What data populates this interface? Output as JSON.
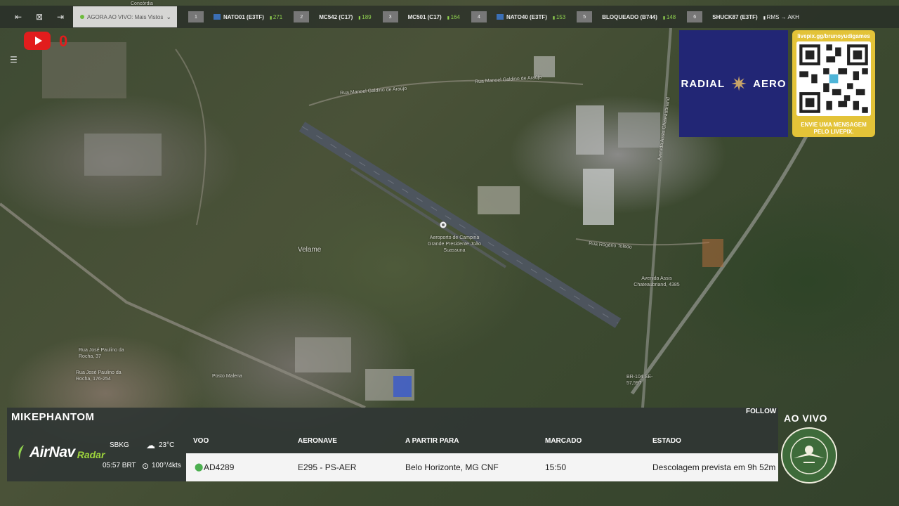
{
  "topbar": {
    "live_label": "AGORA AO VIVO: Mais Vistos",
    "slots": [
      {
        "rank": "1",
        "name": "NATO01 (E3TF)",
        "score": "271"
      },
      {
        "rank": "2",
        "name": "MC542 (C17)",
        "score": "189"
      },
      {
        "rank": "3",
        "name": "MC501 (C17)",
        "score": "164"
      },
      {
        "rank": "4",
        "name": "NATO40 (E3TF)",
        "score": "153"
      },
      {
        "rank": "5",
        "name": "BLOQUEADO (B744)",
        "score": "148"
      },
      {
        "rank": "6",
        "name": "SHUCK87 (E3TF)",
        "score": "RMS → AKH"
      }
    ]
  },
  "youtube": {
    "count": "0"
  },
  "map": {
    "labels": {
      "velame": "Velame",
      "airport": "Aeroporto de Campina Grande Presidente João Suassuna",
      "rua_manoel": "Rua Manoel Galdino de Araújo",
      "rua_manoel_2": "Rua Manoel Galdino de Araújo",
      "avenida_assis": "Avenida Assis Chateaubriand",
      "avenida_assis_2": "Avenida Assis Chateaubriand, 4385",
      "rua_rogerio": "Rua Rogério Toledo",
      "posto": "Posto Malena",
      "rua_paulino": "Rua José Paulino da Rocha, 37",
      "rua_paulino_2": "Rua José Paulino da Rocha, 176-254",
      "br104": "BR-104 SE-57,597",
      "concordia": "Concórdia"
    }
  },
  "sponsor": {
    "brand_left": "RADIAL",
    "brand_right": "AERO",
    "qr_url": "livepix.gg/brunoyudigames",
    "qr_message": "ENVIE UMA MENSAGEM PELO LIVEPIX."
  },
  "panel": {
    "channel": "MIKEPHANTOM",
    "follow": "FOLLOW",
    "brand_main": "AirNav",
    "brand_sub": "Radar",
    "airport_code": "SBKG",
    "local_time": "05:57 BRT",
    "temperature": "23°C",
    "wind": "100°/4kts",
    "headers": {
      "flight": "VOO",
      "aircraft": "AERONAVE",
      "route": "A PARTIR PARA",
      "scheduled": "MARCADO",
      "status": "ESTADO"
    },
    "row": {
      "flight": "AD4289",
      "aircraft": "E295 - PS-AER",
      "route": "Belo Horizonte, MG CNF",
      "scheduled": "15:50",
      "status": "Descolagem prevista em 9h 52m"
    }
  },
  "overlay": {
    "ao_vivo": "AO VIVO"
  },
  "colors": {
    "accent_green": "#8fd14f",
    "youtube_red": "#e21d1d",
    "sponsor_blue": "#222675",
    "livepix_yellow": "#e3c338"
  }
}
